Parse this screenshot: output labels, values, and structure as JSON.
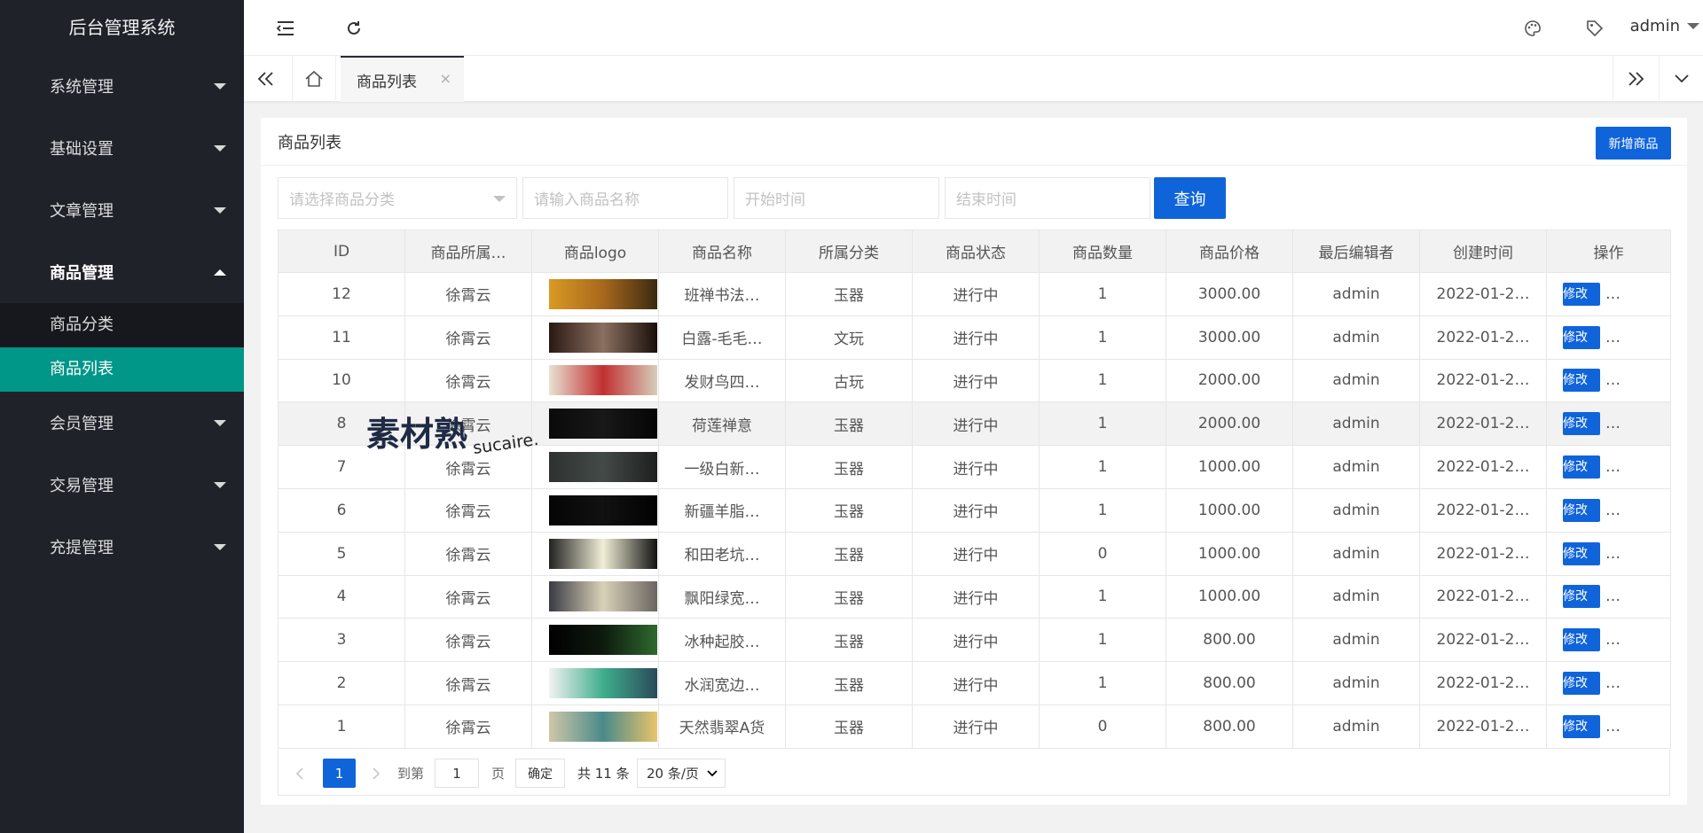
{
  "app": {
    "title": "后台管理系统"
  },
  "sidebar": {
    "items": [
      {
        "label": "系统管理",
        "open": false
      },
      {
        "label": "基础设置",
        "open": false
      },
      {
        "label": "文章管理",
        "open": false
      },
      {
        "label": "商品管理",
        "open": true,
        "children": [
          {
            "label": "商品分类",
            "active": false
          },
          {
            "label": "商品列表",
            "active": true
          }
        ]
      },
      {
        "label": "会员管理",
        "open": false
      },
      {
        "label": "交易管理",
        "open": false
      },
      {
        "label": "充提管理",
        "open": false
      }
    ]
  },
  "header": {
    "user": "admin"
  },
  "tabs": {
    "active_tab": "商品列表",
    "close_glyph": "×"
  },
  "card": {
    "title": "商品列表",
    "add_button": "新增商品"
  },
  "filters": {
    "category_placeholder": "请选择商品分类",
    "name_placeholder": "请输入商品名称",
    "start_placeholder": "开始时间",
    "end_placeholder": "结束时间",
    "query_button": "查询"
  },
  "table": {
    "columns": [
      "ID",
      "商品所属…",
      "商品logo",
      "商品名称",
      "所属分类",
      "商品状态",
      "商品数量",
      "商品价格",
      "最后编辑者",
      "创建时间",
      "操作"
    ],
    "edit_label": "修改",
    "more_label": "…",
    "rows": [
      {
        "id": "12",
        "owner": "徐霄云",
        "name": "班禅书法…",
        "category": "玉器",
        "status": "进行中",
        "qty": "1",
        "price": "3000.00",
        "editor": "admin",
        "created": "2022-01-2…"
      },
      {
        "id": "11",
        "owner": "徐霄云",
        "name": "白露-毛毛…",
        "category": "文玩",
        "status": "进行中",
        "qty": "1",
        "price": "3000.00",
        "editor": "admin",
        "created": "2022-01-2…"
      },
      {
        "id": "10",
        "owner": "徐霄云",
        "name": "发财鸟四…",
        "category": "古玩",
        "status": "进行中",
        "qty": "1",
        "price": "2000.00",
        "editor": "admin",
        "created": "2022-01-2…"
      },
      {
        "id": "8",
        "owner": "徐霄云",
        "name": "荷莲禅意",
        "category": "玉器",
        "status": "进行中",
        "qty": "1",
        "price": "2000.00",
        "editor": "admin",
        "created": "2022-01-2…"
      },
      {
        "id": "7",
        "owner": "徐霄云",
        "name": "一级白新…",
        "category": "玉器",
        "status": "进行中",
        "qty": "1",
        "price": "1000.00",
        "editor": "admin",
        "created": "2022-01-2…"
      },
      {
        "id": "6",
        "owner": "徐霄云",
        "name": "新疆羊脂…",
        "category": "玉器",
        "status": "进行中",
        "qty": "1",
        "price": "1000.00",
        "editor": "admin",
        "created": "2022-01-2…"
      },
      {
        "id": "5",
        "owner": "徐霄云",
        "name": "和田老坑…",
        "category": "玉器",
        "status": "进行中",
        "qty": "0",
        "price": "1000.00",
        "editor": "admin",
        "created": "2022-01-2…"
      },
      {
        "id": "4",
        "owner": "徐霄云",
        "name": "飘阳绿宽…",
        "category": "玉器",
        "status": "进行中",
        "qty": "1",
        "price": "1000.00",
        "editor": "admin",
        "created": "2022-01-2…"
      },
      {
        "id": "3",
        "owner": "徐霄云",
        "name": "冰种起胶…",
        "category": "玉器",
        "status": "进行中",
        "qty": "1",
        "price": "800.00",
        "editor": "admin",
        "created": "2022-01-2…"
      },
      {
        "id": "2",
        "owner": "徐霄云",
        "name": "水润宽边…",
        "category": "玉器",
        "status": "进行中",
        "qty": "1",
        "price": "800.00",
        "editor": "admin",
        "created": "2022-01-2…"
      },
      {
        "id": "1",
        "owner": "徐霄云",
        "name": "天然翡翠A货",
        "category": "玉器",
        "status": "进行中",
        "qty": "0",
        "price": "800.00",
        "editor": "admin",
        "created": "2022-01-2…"
      }
    ]
  },
  "pagination": {
    "current_page": "1",
    "goto_label": "到第",
    "goto_value": "1",
    "page_label": "页",
    "confirm_button": "确定",
    "total_label": "共 11 条",
    "page_size": "20 条/页"
  },
  "watermark": {
    "mark": "素材熟",
    "sub": "sucaire."
  },
  "colors": {
    "sidebar_bg": "#20222a",
    "active_menu": "#009688",
    "primary": "#1064da"
  }
}
